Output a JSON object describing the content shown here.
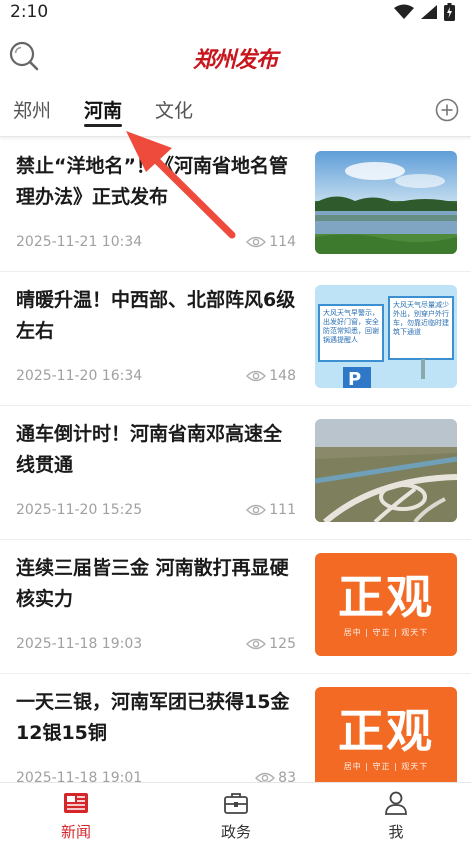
{
  "status_bar": {
    "time": "2:10"
  },
  "header": {
    "logo_text": "郑州发布"
  },
  "tabs": [
    {
      "label": "郑州"
    },
    {
      "label": "河南"
    },
    {
      "label": "文化"
    }
  ],
  "active_tab": "河南",
  "news": [
    {
      "title": "禁止“洋地名”！《河南省地名管理办法》正式发布",
      "date": "2025-11-21 10:34",
      "views": "114",
      "thumb": "lake-landscape"
    },
    {
      "title": "晴暖升温！中西部、北部阵风6级左右",
      "date": "2025-11-20 16:34",
      "views": "148",
      "thumb": "weather-billboard",
      "thumb_texts": [
        "大风天气早警示，出发好门窗，安全防范常知悉，回谢锅遇提醒人",
        "大风天气尽量减少外出，别穿户外行车，勿靠近临时建筑下通道"
      ]
    },
    {
      "title": "通车倒计时！河南省南邓高速全线贯通",
      "date": "2025-11-20 15:25",
      "views": "111",
      "thumb": "highway-interchange"
    },
    {
      "title": "连续三届皆三金 河南散打再显硬核实力",
      "date": "2025-11-18 19:03",
      "views": "125",
      "thumb": "zhengguan-logo"
    },
    {
      "title": "一天三银，河南军团已获得15金12银15铜",
      "date": "2025-11-18 19:01",
      "views": "83",
      "thumb": "zhengguan-logo"
    }
  ],
  "zhengguan": {
    "big": "正观",
    "small": "居中 | 守正 | 观天下"
  },
  "bottom_nav": [
    {
      "label": "新闻",
      "icon": "newspaper-icon",
      "active": true
    },
    {
      "label": "政务",
      "icon": "briefcase-icon",
      "active": false
    },
    {
      "label": "我",
      "icon": "person-icon",
      "active": false
    }
  ],
  "colors": {
    "accent": "#d6262c",
    "logo": "#c8161d",
    "zhengguan": "#f26a24",
    "annotation_arrow": "#ee4b3c"
  }
}
